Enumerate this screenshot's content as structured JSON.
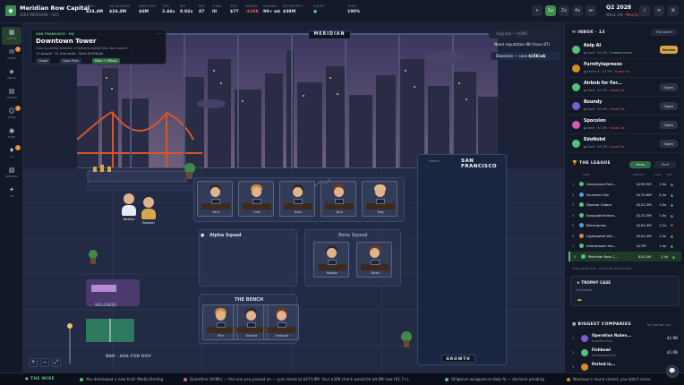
{
  "topbar": {
    "company": "Meridian Row Capital",
    "founder": "ALEX MERIDIAN · CEO",
    "stats": [
      {
        "label": "CASH",
        "value": "$24.4M",
        "tone": "normal"
      },
      {
        "label": "VAL BOOKED",
        "value": "$24.4M",
        "tone": "normal"
      },
      {
        "label": "DEPLOYED",
        "value": "$6M",
        "tone": "normal"
      },
      {
        "label": "TVPI",
        "value": "2.44x",
        "tone": "normal"
      },
      {
        "label": "IRR",
        "value": "0.02x",
        "tone": "normal"
      },
      {
        "label": "REP",
        "value": "87",
        "tone": "normal"
      },
      {
        "label": "FUND",
        "value": "III",
        "tone": "normal"
      },
      {
        "label": "SIZE",
        "value": "$77",
        "tone": "normal"
      },
      {
        "label": "WEEKLY",
        "value": "-$38K",
        "tone": "red"
      },
      {
        "label": "RUNWAY",
        "value": "99+ wk",
        "tone": "normal"
      },
      {
        "label": "NET WORTH",
        "value": "$38M",
        "tone": "normal"
      },
      {
        "label": "EQUITY",
        "value": "●",
        "tone": "green"
      },
      {
        "label": "TEAM",
        "value": "100%",
        "tone": "normal"
      }
    ],
    "speed": {
      "pause": "⏸",
      "x1": "1x",
      "x2": "2x",
      "x4": "4x",
      "skip": "⏭"
    },
    "quarter": "Q2 2028",
    "week_prefix": "Week 2/8 · ",
    "week_status": "Nearby",
    "util_icons": [
      "bell-icon",
      "menu-icon",
      "settings-icon"
    ]
  },
  "sidebar": {
    "items": [
      {
        "label": "OFFICE",
        "icon": "▦",
        "badge": ""
      },
      {
        "label": "INBOX",
        "icon": "✉",
        "badge": "3"
      },
      {
        "label": "DEALS",
        "icon": "◈",
        "badge": ""
      },
      {
        "label": "CHARTS",
        "icon": "▤",
        "badge": ""
      },
      {
        "label": "TEAM",
        "icon": "☺",
        "badge": "2"
      },
      {
        "label": "FUND",
        "icon": "◉",
        "badge": ""
      },
      {
        "label": "LP",
        "icon": "♦",
        "badge": "1"
      },
      {
        "label": "REPORTS",
        "icon": "▧",
        "badge": ""
      },
      {
        "label": "HR",
        "icon": "✦",
        "badge": ""
      }
    ]
  },
  "scene": {
    "location": {
      "tag": "SAN FRANCISCO · HQ",
      "name": "Downtown Tower",
      "desc": "Floor-to-ceiling windows. A formerly named Dov You made it.",
      "info": "10 people · 21 free seats · Rent $430K/wk",
      "chips": [
        "Chase",
        "Open Pods",
        "Pods + Offices"
      ]
    },
    "banner": "MERIDIAN",
    "upgrade": "Upgrade — $60M",
    "need": "Need reputation 88 (have 87)",
    "downsize_label": "Downsize — save ",
    "downsize_value": "$25K/wk",
    "rooms": {
      "alpha": "Alpha Squad",
      "beta": "Beta Squad",
      "bench": "THE BENCH",
      "wellness": "WELLNESS",
      "lounge": "LOUNGE",
      "breakroom": "BREAKROOM"
    },
    "desks_top": [
      {
        "name": "Vera"
      },
      {
        "name": "Cole"
      },
      {
        "name": "Boss"
      },
      {
        "name": "Zara"
      },
      {
        "name": "Toby"
      }
    ],
    "beta_desks": [
      {
        "name": "Bastian"
      },
      {
        "name": "Soren"
      }
    ],
    "bench_desks": [
      {
        "name": "Mira"
      },
      {
        "name": "Daniela"
      },
      {
        "name": "Ambrose"
      }
    ],
    "people": [
      {
        "name": "Beatriz"
      },
      {
        "name": "Bastian"
      }
    ],
    "sf_title": "SAN FRANCISCO",
    "sf_sub": "FUND III",
    "growth": "GROWTH",
    "bar_label": "BAR · ASK FOR DOV",
    "zoom": [
      "+",
      "−",
      "⤢"
    ]
  },
  "panel": {
    "inbox_title": "INBOX · 13",
    "inbox_filter": "Full view ▾",
    "inbox": [
      {
        "name": "Kelp AI",
        "meta": "◆ Seed · $2.4M · ",
        "extra": "3 weeks ready",
        "tone": "warm",
        "action": "Decide",
        "color": "#58c07b"
      },
      {
        "name": "Furnitytapresso",
        "meta": "◆ Series A · $3.5M · ",
        "extra": "closes 6w",
        "tone": "hot",
        "action": "",
        "color": "#d88a2b"
      },
      {
        "name": "Airbnb for Fer...",
        "meta": "◆ Seed · $1.2M · ",
        "extra": "closes 3w",
        "tone": "hot",
        "action": "Open",
        "color": "#58c07b"
      },
      {
        "name": "Boundy",
        "meta": "◆ Seed · $2.4M · ",
        "extra": "closes 3w",
        "tone": "hot",
        "action": "Open",
        "color": "#7a5bd6"
      },
      {
        "name": "Spocolon",
        "meta": "◆ Seed · $1.8M · ",
        "extra": "closes 3w",
        "tone": "hot",
        "action": "Open",
        "color": "#d65bb0"
      },
      {
        "name": "EdoNobd",
        "meta": "◆ Seed · $5.2M · ",
        "extra": "closes 5w",
        "tone": "hot",
        "action": "Open",
        "color": "#58c07b"
      }
    ],
    "league_title": "THE LEAGUE",
    "league_tabs": [
      "Firms",
      "Staff"
    ],
    "league_cols": {
      "firm": "FIRM",
      "val": "WORTH ↓",
      "mult": "MOIC",
      "ch": "RET"
    },
    "league": [
      {
        "rank": "1",
        "name": "Greyhound Part...",
        "val": "$256.3M",
        "mult": "1.9x",
        "ch": "▲",
        "dn": false,
        "color": "#58c07b",
        "me": false
      },
      {
        "rank": "2",
        "name": "Founders Fan",
        "val": "$175.6M",
        "mult": "2.2x",
        "ch": "▲",
        "dn": false,
        "color": "#4aa3d6",
        "me": false
      },
      {
        "rank": "3",
        "name": "Fiperisk Global",
        "val": "$122.3M",
        "mult": "1.5x",
        "ch": "▲",
        "dn": false,
        "color": "#58c07b",
        "me": false
      },
      {
        "rank": "4",
        "name": "Sequoiafundlron...",
        "val": "$125.3M",
        "mult": "1.9x",
        "ch": "▲",
        "dn": false,
        "color": "#58c07b",
        "me": false
      },
      {
        "rank": "5",
        "name": "Benchpress",
        "val": "$104.3M",
        "mult": "1.1x",
        "ch": "▼",
        "dn": true,
        "color": "#4aa3d6",
        "me": false
      },
      {
        "rank": "6",
        "name": "Lightspeed Ven...",
        "val": "$104.0M",
        "mult": "1.2x",
        "ch": "▲",
        "dn": false,
        "color": "#d88a2b",
        "me": false
      },
      {
        "rank": "7",
        "name": "Andreessen Hor...",
        "val": "$27M",
        "mult": "1.4x",
        "ch": "▲",
        "dn": false,
        "color": "#58c07b",
        "me": false
      },
      {
        "rank": "8",
        "name": "Meridian Row C...",
        "val": "$24.4M",
        "mult": "2.4x",
        "ch": "▲",
        "dn": false,
        "color": "#58c07b",
        "me": true
      }
    ],
    "league_note": "Show game chat · click a row item to sort",
    "trophy_title": "TROPHY CASE",
    "trophy_sub": "Heirlooms",
    "trophy_icon": "☁",
    "companies_title": "BIGGEST COMPANIES",
    "companies_filter": "by market cap",
    "companies": [
      {
        "rank": "1",
        "name": "Operation Nuten...",
        "sub": "Founders Fun",
        "val": "$1.9B",
        "color": "#7a5bd6"
      },
      {
        "rank": "2",
        "name": "Fishbowl",
        "sub": "Andreessen Hor...",
        "val": "$1.0B",
        "color": "#58c07b"
      },
      {
        "rank": "3",
        "name": "Parted in...",
        "sub": "",
        "val": "",
        "color": "#d88a2b"
      }
    ]
  },
  "wire": {
    "tag": "THE WIRE",
    "items": [
      {
        "text": "You developed a new trait: Media Darling",
        "color": "#58c07b"
      },
      {
        "text": "Quantline (Ai/ML) — the one you passed on — just raised at $473.9M. Your $30K check would be $4.9M now (61.7×).",
        "color": "#d65bb0"
      },
      {
        "text": "Diligence wrapped on Kelp AI — decision pending",
        "color": "#58c07b"
      },
      {
        "text": "Neuhaus's round closed; you didn't move",
        "color": "#d88a2b"
      }
    ]
  },
  "colors": {
    "accent": "#58c07b",
    "danger": "#e25b5b",
    "gold": "#d6a84a",
    "bg": "#0e1320"
  }
}
